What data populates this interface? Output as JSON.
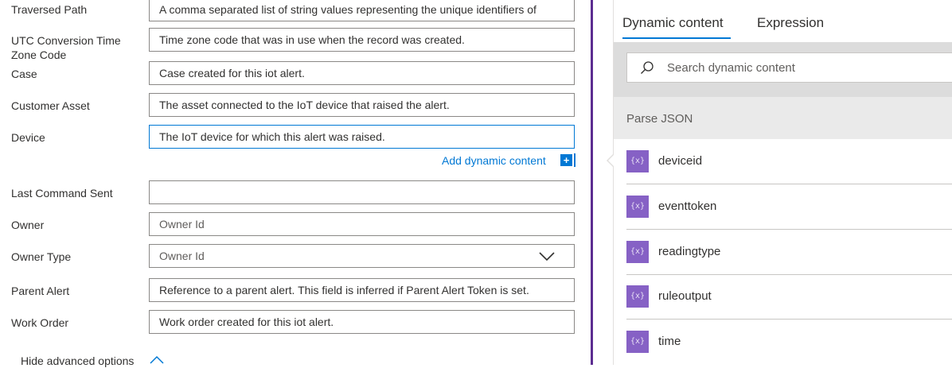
{
  "form": {
    "fields": [
      {
        "label": "Traversed Path",
        "value": "A comma separated list of string values representing the unique identifiers of"
      },
      {
        "label": "UTC Conversion Time Zone Code",
        "value": "Time zone code that was in use when the record was created."
      },
      {
        "label": "Case",
        "value": "Case created for this iot alert."
      },
      {
        "label": "Customer Asset",
        "value": "The asset connected to the IoT device that raised the alert."
      },
      {
        "label": "Device",
        "value": "The IoT device for which this alert was raised."
      },
      {
        "label": "Last Command Sent",
        "value": ""
      },
      {
        "label": "Owner",
        "value": "Owner Id"
      },
      {
        "label": "Owner Type",
        "value": "Owner Id"
      },
      {
        "label": "Parent Alert",
        "value": "Reference to a parent alert. This field is inferred if Parent Alert Token is set."
      },
      {
        "label": "Work Order",
        "value": "Work order created for this iot alert."
      }
    ],
    "add_dynamic_content": "Add dynamic content",
    "add_dynamic_plus": "+",
    "hide_advanced": "Hide advanced options"
  },
  "panel": {
    "tabs": [
      {
        "label": "Dynamic content",
        "active": true
      },
      {
        "label": "Expression",
        "active": false
      }
    ],
    "search_placeholder": "Search dynamic content",
    "section": "Parse JSON",
    "items": [
      {
        "icon": "{x}",
        "label": "deviceid"
      },
      {
        "icon": "{x}",
        "label": "eventtoken"
      },
      {
        "icon": "{x}",
        "label": "readingtype"
      },
      {
        "icon": "{x}",
        "label": "ruleoutput"
      },
      {
        "icon": "{x}",
        "label": "time"
      }
    ]
  },
  "colors": {
    "accent": "#0078d4",
    "divider": "#5c2d91",
    "token_icon": "#8661c5"
  }
}
